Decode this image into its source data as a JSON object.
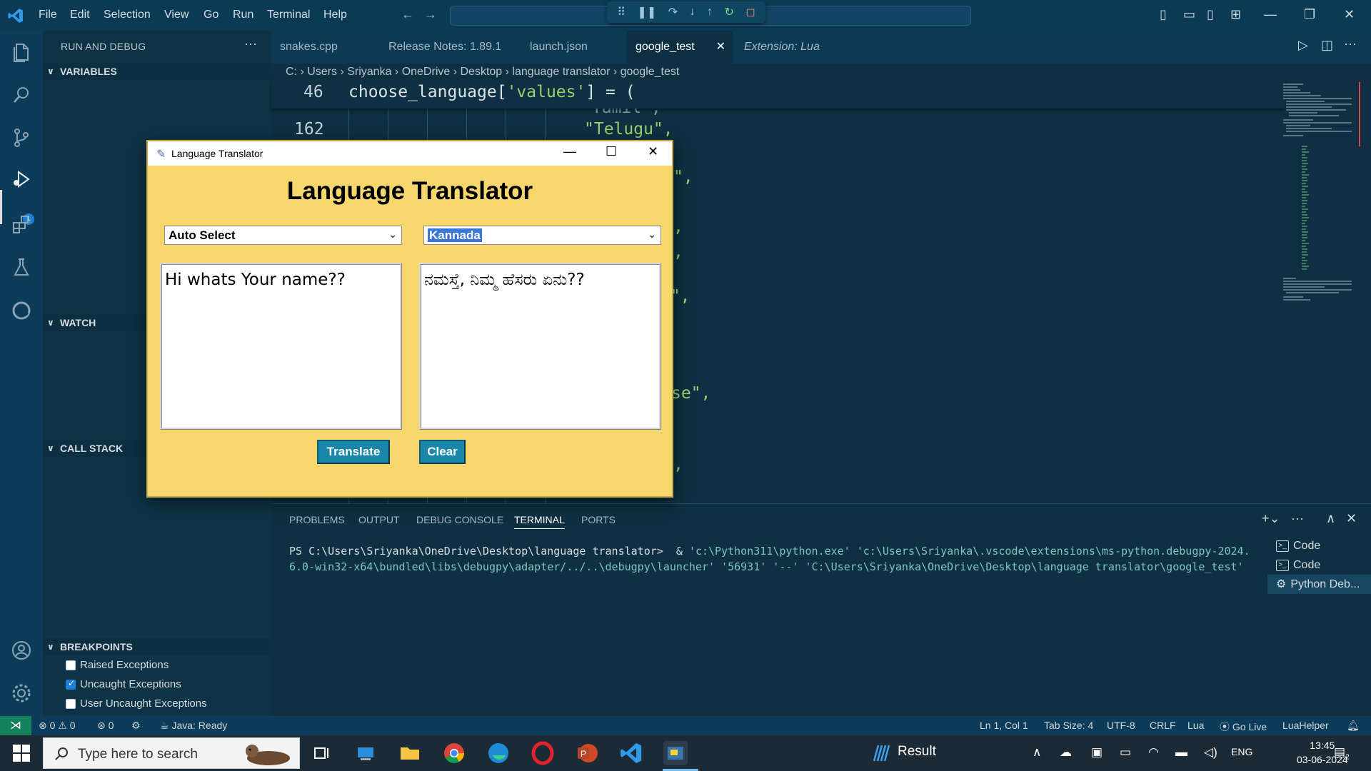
{
  "titlebar": {
    "menu": [
      "File",
      "Edit",
      "Selection",
      "View",
      "Go",
      "Run",
      "Terminal",
      "Help"
    ]
  },
  "sidebar": {
    "title": "RUN AND DEBUG",
    "sections": {
      "variables": "VARIABLES",
      "watch": "WATCH",
      "call_stack": "CALL STACK",
      "breakpoints": "BREAKPOINTS"
    },
    "breakpoints": [
      {
        "label": "Raised Exceptions",
        "checked": false
      },
      {
        "label": "Uncaught Exceptions",
        "checked": true
      },
      {
        "label": "User Uncaught Exceptions",
        "checked": false
      }
    ],
    "run_badge": "1"
  },
  "tabs": [
    {
      "label": "snakes.cpp",
      "active": false
    },
    {
      "label": "Release Notes: 1.89.1",
      "active": false
    },
    {
      "label": "launch.json",
      "active": false
    },
    {
      "label": "google_test",
      "active": true
    },
    {
      "label": "Extension: Lua",
      "active": false,
      "italic": true
    }
  ],
  "breadcrumb": [
    "C:",
    "Users",
    "Sriyanka",
    "OneDrive",
    "Desktop",
    "language translator",
    "google_test"
  ],
  "editor": {
    "sticky_line_no": "46",
    "sticky_code_pre": "choose_language[",
    "sticky_code_str": "'values'",
    "sticky_code_post": "] = (",
    "line_no_162": "162",
    "line_162_code": "\"Telugu\",",
    "fragment_1": "\",",
    "fragment_2": ",",
    "fragment_3": ",",
    "fragment_4": "n\",",
    "fragment_5": "se\",",
    "fragment_6": ","
  },
  "panel": {
    "tabs": [
      "PROBLEMS",
      "OUTPUT",
      "DEBUG CONSOLE",
      "TERMINAL",
      "PORTS"
    ],
    "active_tab": "TERMINAL",
    "prompt": "PS C:\\Users\\Sriyanka\\OneDrive\\Desktop\\language translator>  & ",
    "cmd": "'c:\\Python311\\python.exe' 'c:\\Users\\Sriyanka\\.vscode\\extensions\\ms-python.debugpy-2024.6.0-win32-x64\\bundled\\libs\\debugpy\\adapter/../..\\debugpy\\launcher' '56931' '--' 'C:\\Users\\Sriyanka\\OneDrive\\Desktop\\language translator\\google_test'",
    "terminals": [
      "Code",
      "Code",
      "Python Deb..."
    ]
  },
  "statusbar": {
    "errors": "0",
    "warnings": "0",
    "ports": "0",
    "java": "Java: Ready",
    "position": "Ln 1, Col 1",
    "tab_size": "Tab Size: 4",
    "encoding": "UTF-8",
    "eol": "CRLF",
    "language": "Lua",
    "golive": "Go Live",
    "luahelper": "LuaHelper"
  },
  "taskbar": {
    "search_placeholder": "Type here to search",
    "result_label": "Result",
    "lang": "ENG",
    "time": "13:45",
    "date": "03-06-2024",
    "notif_count": "2"
  },
  "tkwindow": {
    "title": "Language Translator",
    "heading": "Language Translator",
    "source_lang": "Auto Select",
    "target_lang": "Kannada",
    "input_text": "Hi whats Your name??",
    "output_text": "ನಮಸ್ತೆ, ನಿಮ್ಮ ಹೆಸರು ಏನು??",
    "translate_btn": "Translate",
    "clear_btn": "Clear"
  },
  "colors": {
    "tk_background": "#f5d76e",
    "tk_button": "#1b87a8",
    "editor_bg": "#0e3042",
    "string": "#9ad06f"
  }
}
